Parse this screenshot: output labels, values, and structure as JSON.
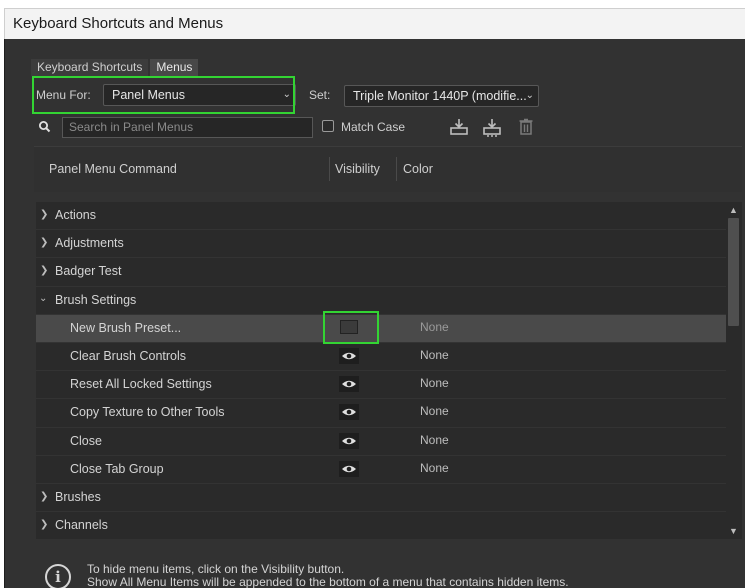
{
  "window": {
    "title": "Keyboard Shortcuts and Menus"
  },
  "tabs": [
    {
      "label": "Keyboard Shortcuts",
      "active": false
    },
    {
      "label": "Menus",
      "active": true
    }
  ],
  "menu_for": {
    "label": "Menu For:",
    "value": "Panel Menus"
  },
  "set": {
    "label": "Set:",
    "value": "Triple Monitor 1440P (modifie..."
  },
  "search": {
    "placeholder": "Search in Panel Menus"
  },
  "match_case": {
    "label": "Match Case",
    "checked": false
  },
  "columns": {
    "command": "Panel Menu Command",
    "visibility": "Visibility",
    "color": "Color"
  },
  "rows": [
    {
      "type": "group",
      "name": "Actions",
      "expanded": false
    },
    {
      "type": "group",
      "name": "Adjustments",
      "expanded": false
    },
    {
      "type": "group",
      "name": "Badger Test",
      "expanded": false
    },
    {
      "type": "group",
      "name": "Brush Settings",
      "expanded": true
    },
    {
      "type": "item",
      "name": "New Brush Preset...",
      "visible": false,
      "color": "None",
      "selected": true
    },
    {
      "type": "item",
      "name": "Clear Brush Controls",
      "visible": true,
      "color": "None"
    },
    {
      "type": "item",
      "name": "Reset All Locked Settings",
      "visible": true,
      "color": "None"
    },
    {
      "type": "item",
      "name": "Copy Texture to Other Tools",
      "visible": true,
      "color": "None"
    },
    {
      "type": "item",
      "name": "Close",
      "visible": true,
      "color": "None"
    },
    {
      "type": "item",
      "name": "Close Tab Group",
      "visible": true,
      "color": "None"
    },
    {
      "type": "group",
      "name": "Brushes",
      "expanded": false
    },
    {
      "type": "group",
      "name": "Channels",
      "expanded": false
    }
  ],
  "info": {
    "line1": "To hide menu items, click on the Visibility button.",
    "line2": "Show All Menu Items will be appended to the bottom of a menu that contains hidden items."
  },
  "colors": {
    "panel": "#323232",
    "list": "#2a2a2a",
    "selected_row": "#4a4a4a",
    "highlight": "#33d433"
  },
  "icons": [
    "search-icon",
    "save-set-icon",
    "save-set-as-icon",
    "delete-set-icon",
    "eye-icon",
    "info-icon",
    "chevron-right-icon",
    "chevron-down-icon"
  ]
}
